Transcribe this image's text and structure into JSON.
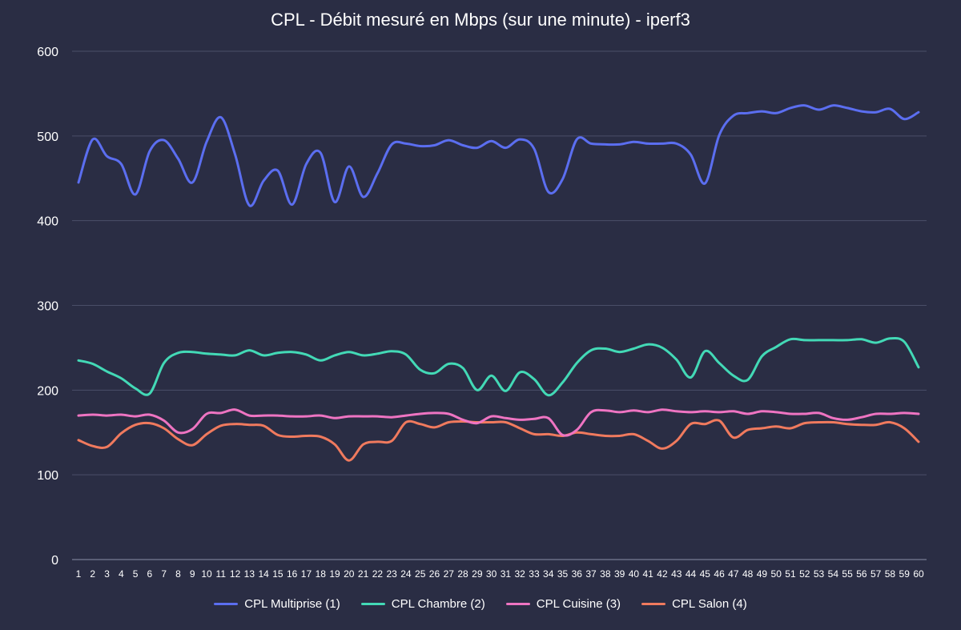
{
  "chart_data": {
    "type": "line",
    "title": "CPL - Débit mesuré en Mbps (sur une minute) - iperf3",
    "xlabel": "",
    "ylabel": "",
    "ylim": [
      0,
      600
    ],
    "yticks": [
      0,
      100,
      200,
      300,
      400,
      500,
      600
    ],
    "grid": true,
    "legend_position": "bottom",
    "categories": [
      "1",
      "2",
      "3",
      "4",
      "5",
      "6",
      "7",
      "8",
      "9",
      "10",
      "11",
      "12",
      "13",
      "14",
      "15",
      "16",
      "17",
      "18",
      "19",
      "20",
      "21",
      "22",
      "23",
      "24",
      "25",
      "26",
      "27",
      "28",
      "29",
      "30",
      "31",
      "32",
      "33",
      "34",
      "35",
      "36",
      "37",
      "38",
      "39",
      "40",
      "41",
      "42",
      "43",
      "44",
      "45",
      "46",
      "47",
      "48",
      "49",
      "50",
      "51",
      "52",
      "53",
      "54",
      "55",
      "56",
      "57",
      "58",
      "59",
      "60"
    ],
    "series": [
      {
        "name": "CPL Multiprise (1)",
        "color": "#5b6ef0",
        "values": [
          445,
          496,
          476,
          467,
          431,
          482,
          495,
          473,
          445,
          493,
          522,
          478,
          418,
          447,
          459,
          419,
          467,
          480,
          422,
          464,
          428,
          456,
          490,
          491,
          488,
          489,
          495,
          489,
          486,
          494,
          486,
          496,
          485,
          434,
          449,
          496,
          491,
          490,
          490,
          493,
          491,
          491,
          491,
          478,
          444,
          501,
          524,
          527,
          529,
          527,
          533,
          536,
          531,
          536,
          533,
          529,
          528,
          532,
          520,
          528
        ]
      },
      {
        "name": "CPL Chambre (2)",
        "color": "#43d9b6",
        "values": [
          235,
          231,
          222,
          214,
          202,
          196,
          232,
          244,
          245,
          243,
          242,
          241,
          247,
          241,
          244,
          245,
          242,
          235,
          241,
          245,
          241,
          243,
          246,
          242,
          224,
          220,
          231,
          226,
          200,
          217,
          199,
          221,
          213,
          194,
          209,
          232,
          247,
          249,
          245,
          249,
          254,
          250,
          236,
          215,
          246,
          232,
          217,
          212,
          240,
          251,
          260,
          259,
          259,
          259,
          259,
          260,
          256,
          261,
          257,
          227
        ]
      },
      {
        "name": "CPL Cuisine (3)",
        "color": "#ee74c2",
        "values": [
          170,
          171,
          170,
          171,
          169,
          171,
          164,
          150,
          154,
          172,
          173,
          177,
          170,
          170,
          170,
          169,
          169,
          170,
          167,
          169,
          169,
          169,
          168,
          170,
          172,
          173,
          172,
          165,
          161,
          169,
          167,
          165,
          166,
          167,
          147,
          153,
          174,
          176,
          174,
          176,
          174,
          177,
          175,
          174,
          175,
          174,
          175,
          172,
          175,
          174,
          172,
          172,
          173,
          167,
          165,
          168,
          172,
          172,
          173,
          172
        ]
      },
      {
        "name": "CPL Salon (4)",
        "color": "#f07a5e",
        "values": [
          141,
          134,
          133,
          149,
          159,
          161,
          155,
          142,
          135,
          148,
          158,
          160,
          159,
          158,
          147,
          145,
          146,
          145,
          136,
          117,
          136,
          139,
          140,
          162,
          160,
          156,
          162,
          163,
          162,
          162,
          162,
          155,
          148,
          148,
          146,
          150,
          148,
          146,
          146,
          148,
          140,
          131,
          140,
          160,
          160,
          164,
          144,
          153,
          155,
          157,
          155,
          161,
          162,
          162,
          160,
          159,
          159,
          162,
          155,
          139
        ]
      }
    ]
  }
}
